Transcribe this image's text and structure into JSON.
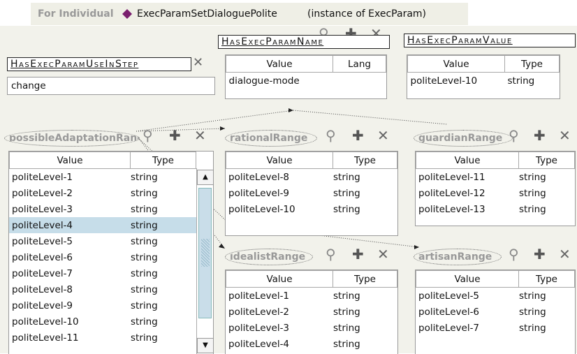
{
  "header": {
    "prefix": "For Individual",
    "individual": "ExecParamSetDialoguePolite",
    "instance_of": "(instance of ExecParam)"
  },
  "colors": {
    "individual_marker": "#7a1f6e",
    "selection": "#c6dde9"
  },
  "slots": {
    "use_in_step": {
      "title": "HasExecParamUseInStep",
      "value": "change"
    },
    "param_name": {
      "title": "HasExecParamName",
      "columns": [
        "Value",
        "Lang"
      ],
      "rows": [
        [
          "dialogue-mode",
          ""
        ]
      ]
    },
    "param_value": {
      "title": "HasExecParamValue",
      "columns": [
        "Value",
        "Type"
      ],
      "rows": [
        [
          "politeLevel-10",
          "string"
        ]
      ]
    }
  },
  "ranges": {
    "possible": {
      "label": "possibleAdaptationRange",
      "columns": [
        "Value",
        "Type"
      ],
      "rows": [
        [
          "politeLevel-1",
          "string"
        ],
        [
          "politeLevel-2",
          "string"
        ],
        [
          "politeLevel-3",
          "string"
        ],
        [
          "politeLevel-4",
          "string"
        ],
        [
          "politeLevel-5",
          "string"
        ],
        [
          "politeLevel-6",
          "string"
        ],
        [
          "politeLevel-7",
          "string"
        ],
        [
          "politeLevel-8",
          "string"
        ],
        [
          "politeLevel-9",
          "string"
        ],
        [
          "politeLevel-10",
          "string"
        ],
        [
          "politeLevel-11",
          "string"
        ]
      ],
      "selected_row": "politeLevel-4"
    },
    "rational": {
      "label": "rationalRange",
      "columns": [
        "Value",
        "Type"
      ],
      "rows": [
        [
          "politeLevel-8",
          "string"
        ],
        [
          "politeLevel-9",
          "string"
        ],
        [
          "politeLevel-10",
          "string"
        ]
      ]
    },
    "guardian": {
      "label": "guardianRange",
      "columns": [
        "Value",
        "Type"
      ],
      "rows": [
        [
          "politeLevel-11",
          "string"
        ],
        [
          "politeLevel-12",
          "string"
        ],
        [
          "politeLevel-13",
          "string"
        ]
      ]
    },
    "idealist": {
      "label": "idealistRange",
      "columns": [
        "Value",
        "Type"
      ],
      "rows": [
        [
          "politeLevel-1",
          "string"
        ],
        [
          "politeLevel-2",
          "string"
        ],
        [
          "politeLevel-3",
          "string"
        ],
        [
          "politeLevel-4",
          "string"
        ]
      ]
    },
    "artisan": {
      "label": "artisanRange",
      "columns": [
        "Value",
        "Type"
      ],
      "rows": [
        [
          "politeLevel-5",
          "string"
        ],
        [
          "politeLevel-6",
          "string"
        ],
        [
          "politeLevel-7",
          "string"
        ]
      ]
    }
  },
  "icons": {
    "key": "key-icon",
    "add": "add-icon",
    "remove": "remove-icon",
    "scroll_up": "arrow-up-icon",
    "scroll_down": "arrow-down-icon"
  }
}
